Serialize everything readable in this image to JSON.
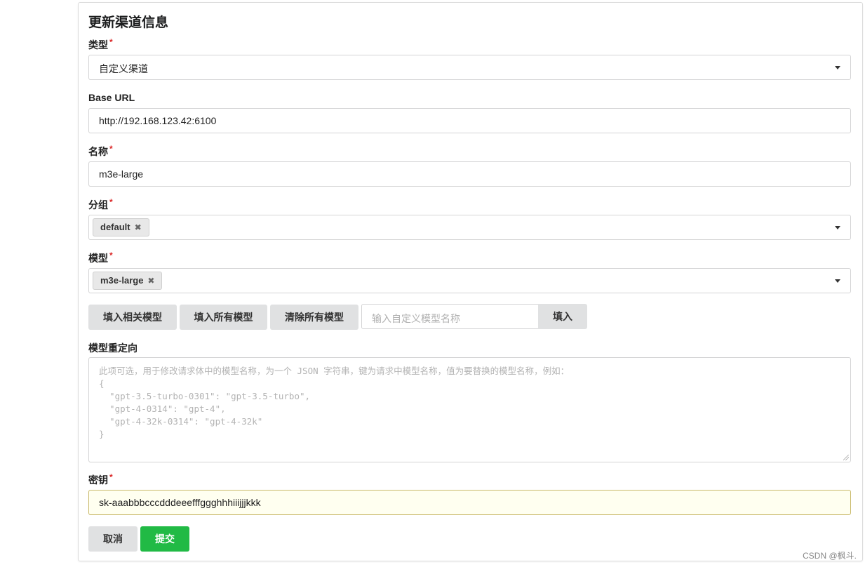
{
  "title": "更新渠道信息",
  "fields": {
    "type": {
      "label": "类型",
      "required": "*",
      "value": "自定义渠道"
    },
    "base_url": {
      "label": "Base URL",
      "value": "http://192.168.123.42:6100"
    },
    "name": {
      "label": "名称",
      "required": "*",
      "value": "m3e-large"
    },
    "group": {
      "label": "分组",
      "required": "*",
      "chips": [
        "default"
      ]
    },
    "model": {
      "label": "模型",
      "required": "*",
      "chips": [
        "m3e-large"
      ]
    },
    "model_mapping": {
      "label": "模型重定向",
      "placeholder": "此项可选，用于修改请求体中的模型名称，为一个 JSON 字符串，键为请求中模型名称，值为要替换的模型名称，例如：\n{\n  \"gpt-3.5-turbo-0301\": \"gpt-3.5-turbo\",\n  \"gpt-4-0314\": \"gpt-4\",\n  \"gpt-4-32k-0314\": \"gpt-4-32k\"\n}"
    },
    "key": {
      "label": "密钥",
      "required": "*",
      "value": "sk-aaabbbcccdddeeefffggghhhiiijjjkkk"
    }
  },
  "model_buttons": {
    "fill_related": "填入相关模型",
    "fill_all": "填入所有模型",
    "clear_all": "清除所有模型",
    "custom_placeholder": "输入自定义模型名称",
    "fill": "填入"
  },
  "actions": {
    "cancel": "取消",
    "submit": "提交"
  },
  "chip_remove_icon": "✖",
  "watermark": "CSDN @枫斗.",
  "colors": {
    "submit": "#21ba45",
    "required": "#db2828"
  }
}
